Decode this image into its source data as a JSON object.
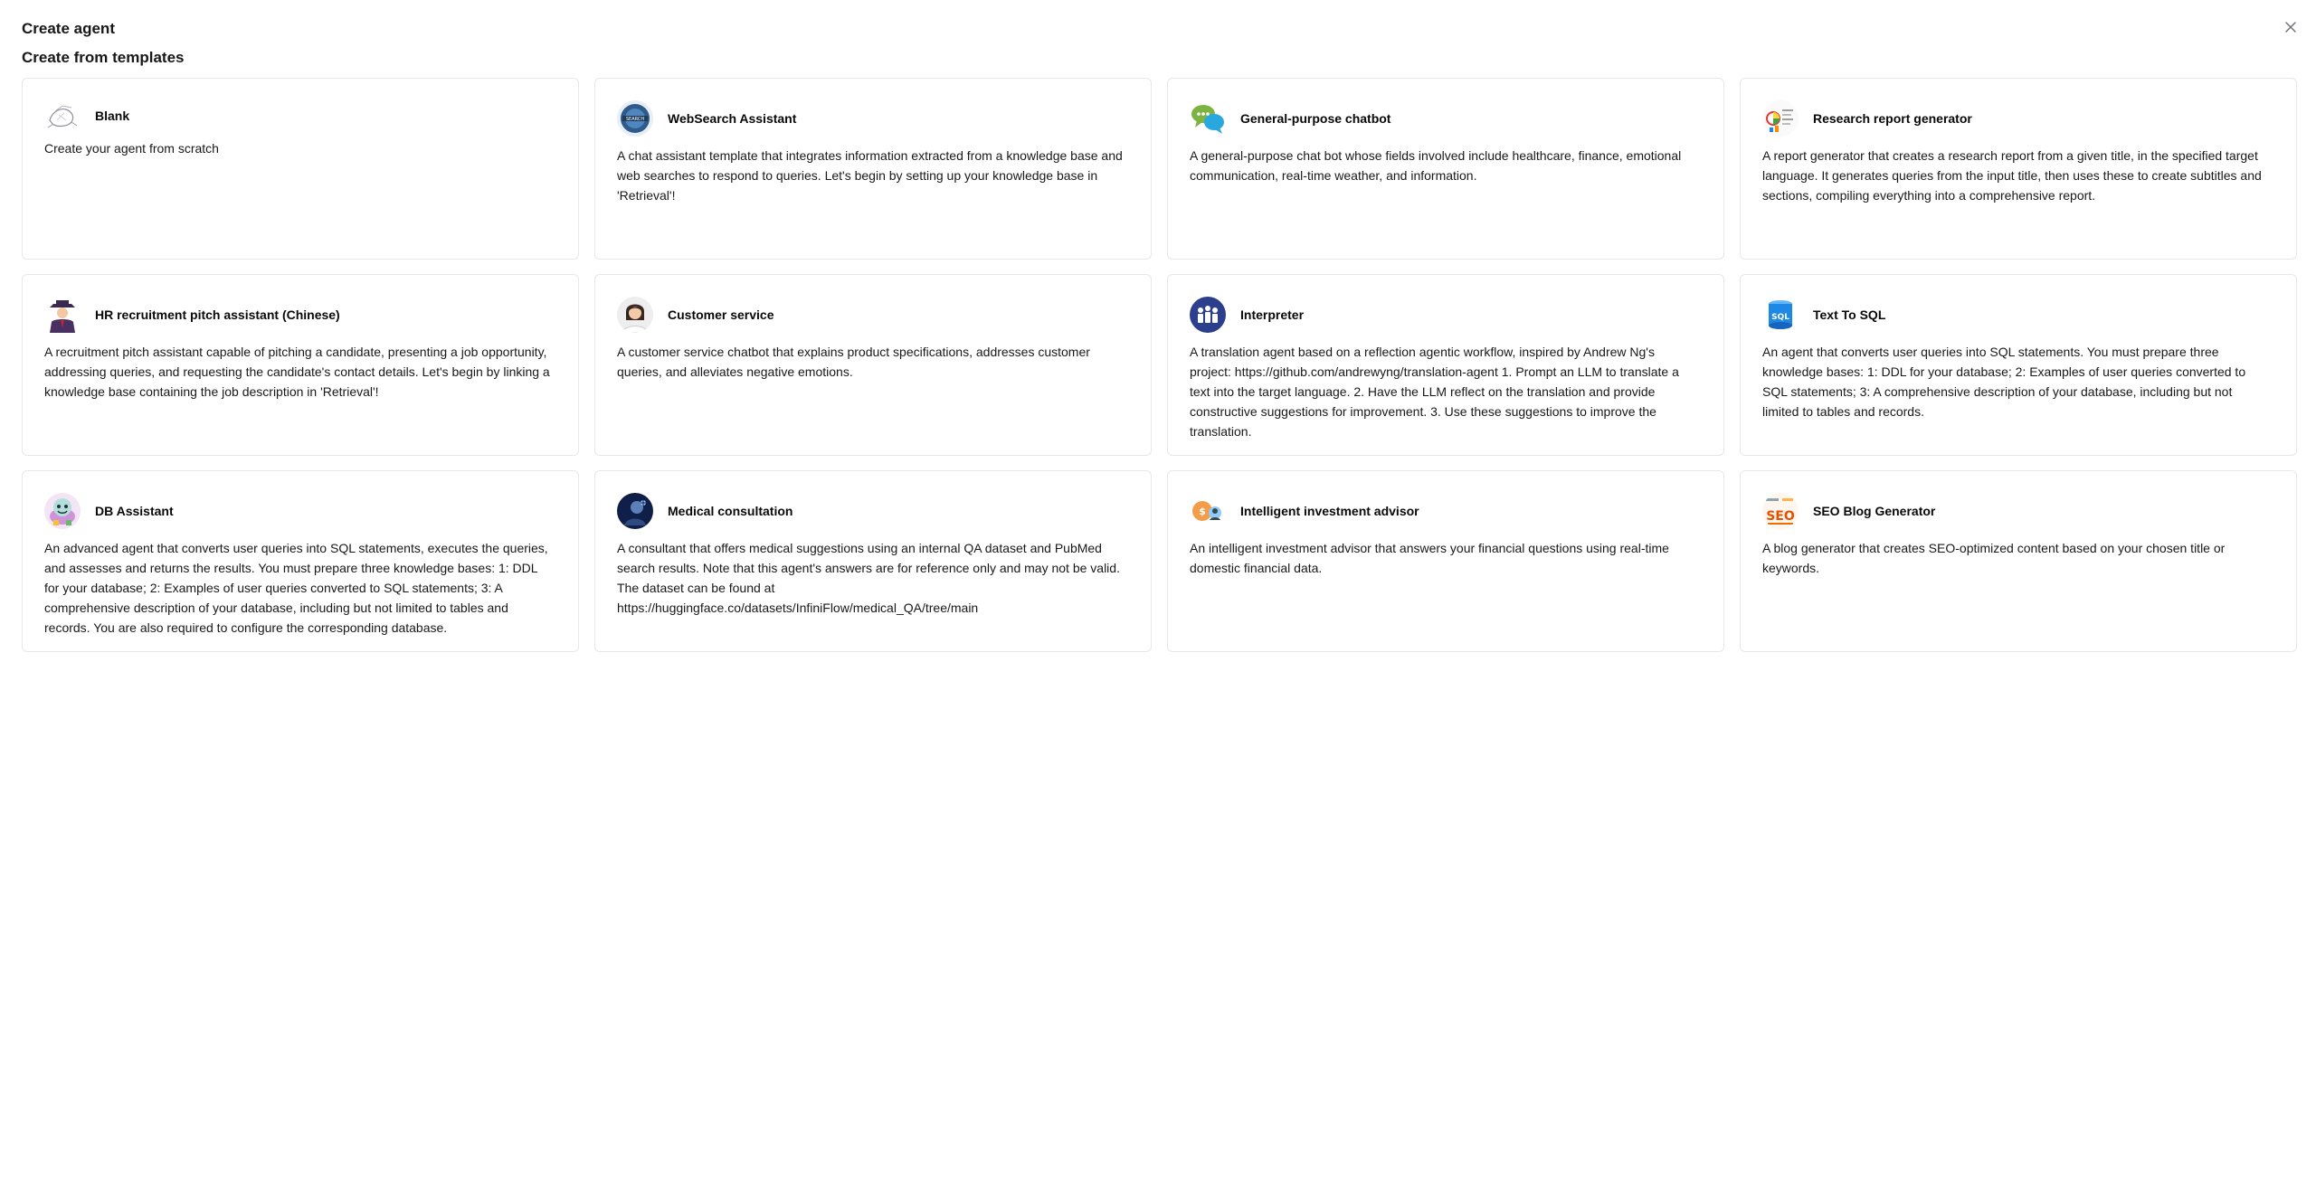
{
  "dialog": {
    "title": "Create agent",
    "section_title": "Create from templates",
    "close_icon": "close-icon"
  },
  "templates": [
    {
      "title": "Blank",
      "description": "Create your agent from scratch",
      "icon": "blank-sketch-icon"
    },
    {
      "title": "WebSearch Assistant",
      "description": "A chat assistant template that integrates information extracted from a knowledge base and web searches to respond to queries. Let's begin by setting up your knowledge base in 'Retrieval'!",
      "icon": "web-search-icon"
    },
    {
      "title": "General-purpose chatbot",
      "description": "A general-purpose chat bot whose fields involved include healthcare, finance, emotional communication, real-time weather, and information.",
      "icon": "chat-bubbles-icon"
    },
    {
      "title": "Research report generator",
      "description": "A report generator that creates a research report from a given title, in the specified target language. It generates queries from the input title, then uses these to create subtitles and sections, compiling everything into a comprehensive report.",
      "icon": "report-icon"
    },
    {
      "title": "HR recruitment pitch assistant (Chinese)",
      "description": "A recruitment pitch assistant capable of pitching a candidate, presenting a job opportunity, addressing queries, and requesting the candidate's contact details. Let's begin by linking a knowledge base containing the job description in 'Retrieval'!",
      "icon": "recruiter-icon"
    },
    {
      "title": "Customer service",
      "description": "A customer service chatbot that explains product specifications, addresses customer queries, and alleviates negative emotions.",
      "icon": "customer-service-icon"
    },
    {
      "title": "Interpreter",
      "description": "A translation agent based on a reflection agentic workflow, inspired by Andrew Ng's project: https://github.com/andrewyng/translation-agent 1. Prompt an LLM to translate a text into the target language. 2. Have the LLM reflect on the translation and provide constructive suggestions for improvement. 3. Use these suggestions to improve the translation.",
      "icon": "interpreter-icon"
    },
    {
      "title": "Text To SQL",
      "description": "An agent that converts user queries into SQL statements. You must prepare three knowledge bases: 1: DDL for your database; 2: Examples of user queries converted to SQL statements; 3: A comprehensive description of your database, including but not limited to tables and records.",
      "icon": "sql-database-icon"
    },
    {
      "title": "DB Assistant",
      "description": "An advanced agent that converts user queries into SQL statements, executes the queries, and assesses and returns the results. You must prepare three knowledge bases: 1: DDL for your database; 2: Examples of user queries converted to SQL statements; 3: A comprehensive description of your database, including but not limited to tables and records. You are also required to configure the corresponding database.",
      "icon": "db-assistant-icon"
    },
    {
      "title": "Medical consultation",
      "description": "A consultant that offers medical suggestions using an internal QA dataset and PubMed search results. Note that this agent's answers are for reference only and may not be valid. The dataset can be found at https://huggingface.co/datasets/InfiniFlow/medical_QA/tree/main",
      "icon": "medical-icon"
    },
    {
      "title": "Intelligent investment advisor",
      "description": "An intelligent investment advisor that answers your financial questions using real-time domestic financial data.",
      "icon": "investment-icon"
    },
    {
      "title": "SEO Blog Generator",
      "description": "A blog generator that creates SEO-optimized content based on your chosen title or keywords.",
      "icon": "seo-icon"
    }
  ]
}
